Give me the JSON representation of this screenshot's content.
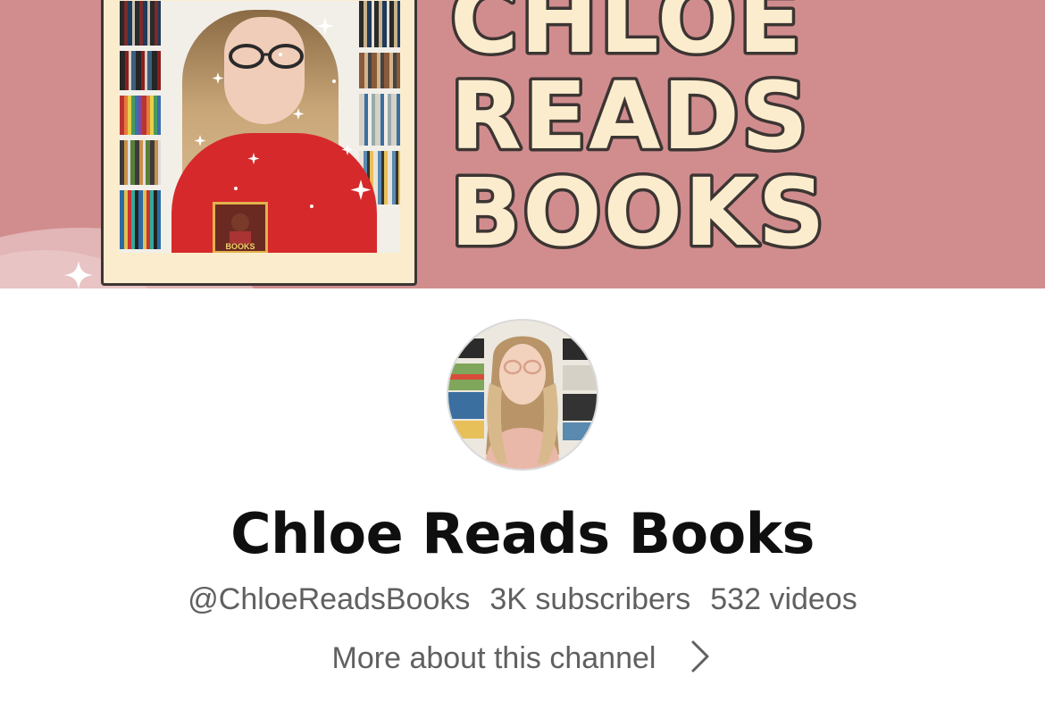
{
  "banner": {
    "title_lines": [
      "CHLOE",
      "READS",
      "BOOKS"
    ],
    "print_text": "BOOKS",
    "colors": {
      "background": "#d18d8e",
      "title_fill": "#fbeccd",
      "title_outline": "#3c3533",
      "sweater": "#d6292b"
    }
  },
  "channel": {
    "name": "Chloe Reads Books",
    "handle": "@ChloeReadsBooks",
    "subscribers": "3K subscribers",
    "videos": "532 videos",
    "more_label": "More about this channel",
    "more_icon": "chevron-right-icon"
  }
}
